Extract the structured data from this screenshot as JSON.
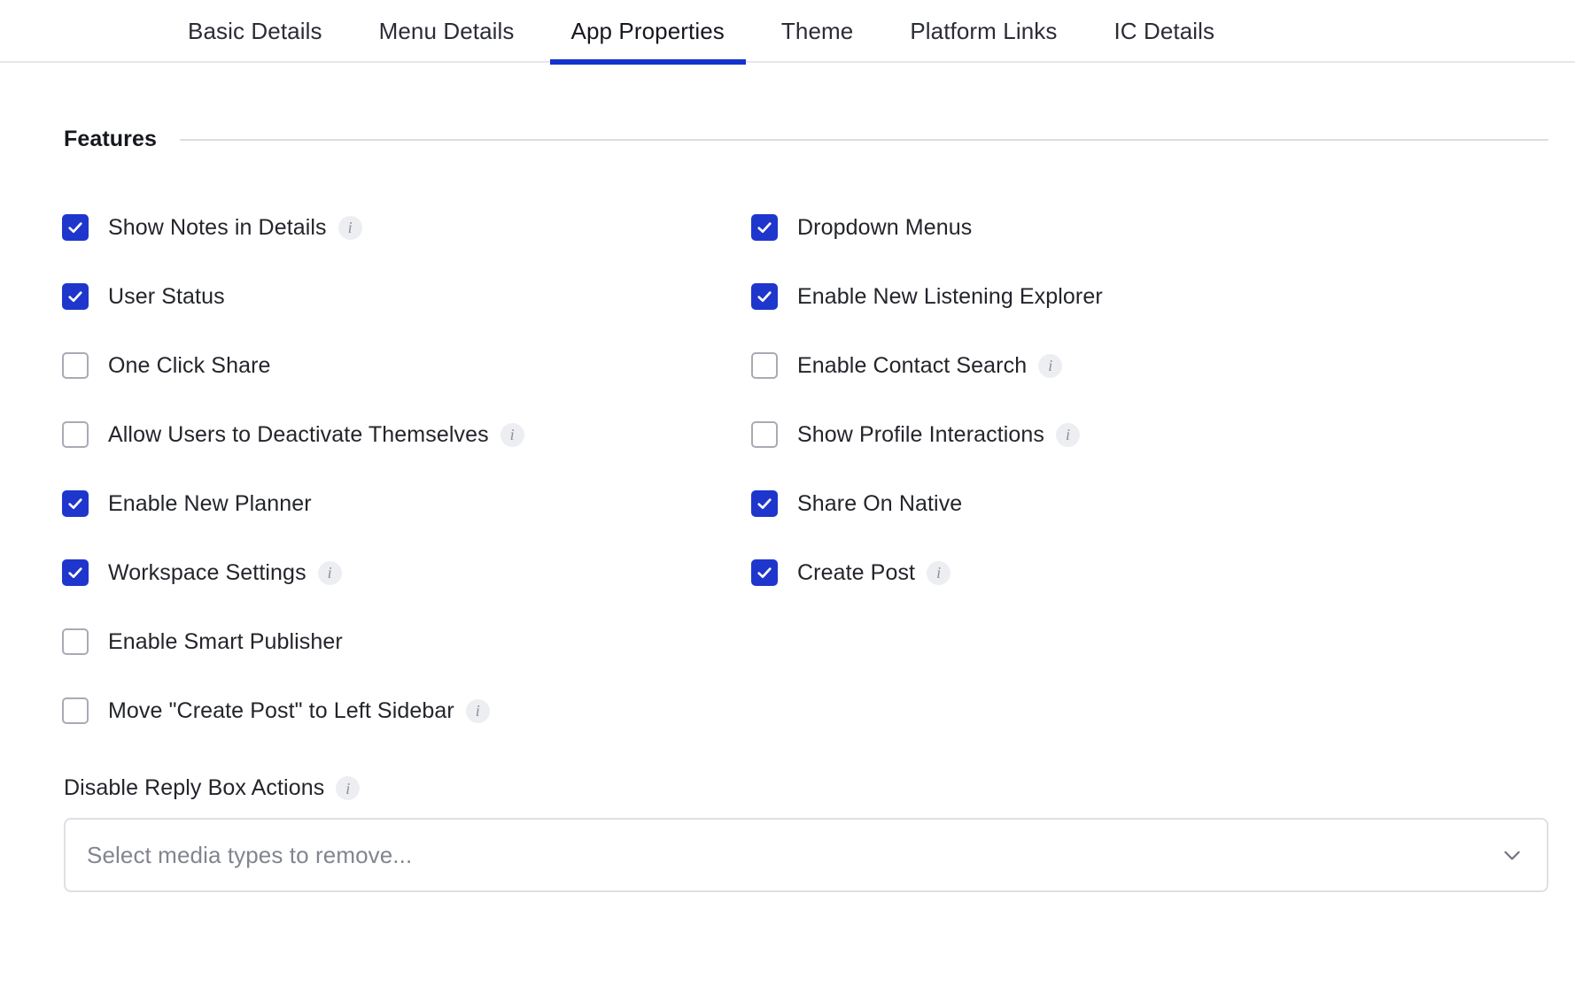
{
  "tabs": [
    {
      "label": "Basic Details",
      "active": false
    },
    {
      "label": "Menu Details",
      "active": false
    },
    {
      "label": "App Properties",
      "active": true
    },
    {
      "label": "Theme",
      "active": false
    },
    {
      "label": "Platform Links",
      "active": false
    },
    {
      "label": "IC Details",
      "active": false
    }
  ],
  "section": {
    "title": "Features"
  },
  "features": {
    "left": [
      {
        "label": "Show Notes in Details",
        "checked": true,
        "info": true
      },
      {
        "label": "User Status",
        "checked": true,
        "info": false
      },
      {
        "label": "One Click Share",
        "checked": false,
        "info": false
      },
      {
        "label": "Allow Users to Deactivate Themselves",
        "checked": false,
        "info": true
      },
      {
        "label": "Enable New Planner",
        "checked": true,
        "info": false
      },
      {
        "label": "Workspace Settings",
        "checked": true,
        "info": true
      },
      {
        "label": "Enable Smart Publisher",
        "checked": false,
        "info": false
      },
      {
        "label": "Move \"Create Post\" to Left Sidebar",
        "checked": false,
        "info": true
      }
    ],
    "right": [
      {
        "label": "Dropdown Menus",
        "checked": true,
        "info": false
      },
      {
        "label": "Enable New Listening Explorer",
        "checked": true,
        "info": false
      },
      {
        "label": "Enable Contact Search",
        "checked": false,
        "info": true
      },
      {
        "label": "Show Profile Interactions",
        "checked": false,
        "info": true
      },
      {
        "label": "Share On Native",
        "checked": true,
        "info": false
      },
      {
        "label": "Create Post",
        "checked": true,
        "info": true
      }
    ]
  },
  "reply_box": {
    "label": "Disable Reply Box Actions",
    "info": true,
    "placeholder": "Select media types to remove...",
    "value": ""
  },
  "icons": {
    "info": "info-icon",
    "check": "check-icon",
    "chevron": "chevron-down-icon"
  },
  "colors": {
    "accent": "#1f36cd",
    "tab_underline": "#1333cc",
    "checkbox_border": "#a8abb4",
    "divider": "#dcdde2",
    "placeholder": "#82858f"
  }
}
